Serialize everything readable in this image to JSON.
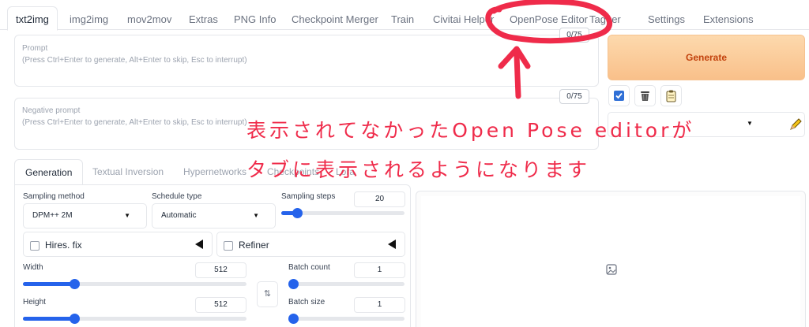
{
  "tabs": [
    "txt2img",
    "img2img",
    "mov2mov",
    "Extras",
    "PNG Info",
    "Checkpoint Merger",
    "Train",
    "Civitai Helper",
    "OpenPose Editor",
    "Tagger",
    "Settings",
    "Extensions"
  ],
  "prompt": {
    "label": "Prompt",
    "placeholder": "(Press Ctrl+Enter to generate, Alt+Enter to skip, Esc to interrupt)",
    "token_count": "0/75"
  },
  "negative_prompt": {
    "label": "Negative prompt",
    "placeholder": "(Press Ctrl+Enter to generate, Alt+Enter to skip, Esc to interrupt)",
    "token_count": "0/75"
  },
  "generate_label": "Generate",
  "tool_icons": [
    "checkbox-icon",
    "trash-icon",
    "clipboard-icon"
  ],
  "subtabs": [
    "Generation",
    "Textual Inversion",
    "Hypernetworks",
    "Checkpoints",
    "Lora"
  ],
  "sampling_method": {
    "label": "Sampling method",
    "value": "DPM++ 2M"
  },
  "schedule_type": {
    "label": "Schedule type",
    "value": "Automatic"
  },
  "sampling_steps": {
    "label": "Sampling steps",
    "value": "20",
    "fraction": 0.13
  },
  "hires_fix_label": "Hires. fix",
  "refiner_label": "Refiner",
  "width": {
    "label": "Width",
    "value": "512",
    "fraction": 0.23
  },
  "height": {
    "label": "Height",
    "value": "512",
    "fraction": 0.23
  },
  "batch_count": {
    "label": "Batch count",
    "value": "1",
    "fraction": 0.0
  },
  "batch_size": {
    "label": "Batch size",
    "value": "1",
    "fraction": 0.0
  },
  "annotation": {
    "line1": "表示されてなかったOpen Pose editorが",
    "line2": "タブに表示されるようになります"
  },
  "colors": {
    "accent": "#2563eb",
    "annotation": "#ef2b4a",
    "generate": "#f9c08a"
  }
}
